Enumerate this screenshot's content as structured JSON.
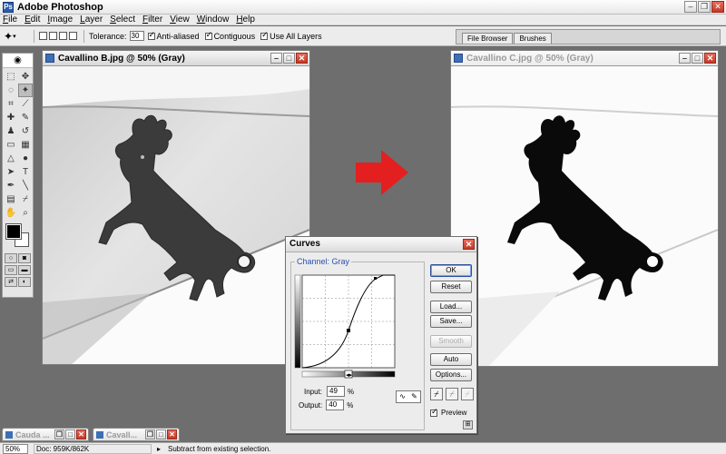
{
  "app": {
    "title": "Adobe Photoshop",
    "logo": "Ps"
  },
  "menu": [
    "File",
    "Edit",
    "Image",
    "Layer",
    "Select",
    "Filter",
    "View",
    "Window",
    "Help"
  ],
  "options": {
    "tolerance_label": "Tolerance:",
    "tolerance_value": "30",
    "anti_aliased": "Anti-aliased",
    "contiguous": "Contiguous",
    "use_all_layers": "Use All Layers"
  },
  "palette_well": {
    "tabs": [
      "File Browser",
      "Brushes"
    ]
  },
  "docs": {
    "left_title": "Cavallino B.jpg @ 50% (Gray)",
    "right_title": "Cavallino C.jpg @ 50% (Gray)"
  },
  "curves": {
    "title": "Curves",
    "channel_label": "Channel:",
    "channel_value": "Gray",
    "ok": "OK",
    "reset": "Reset",
    "load": "Load...",
    "save": "Save...",
    "smooth": "Smooth",
    "auto": "Auto",
    "options": "Options...",
    "input_label": "Input:",
    "input_value": "49",
    "output_label": "Output:",
    "output_value": "40",
    "percent": "%",
    "preview": "Preview"
  },
  "minimized": [
    {
      "title": "Cauda ..."
    },
    {
      "title": "Cavall..."
    }
  ],
  "status": {
    "zoom": "50%",
    "doc_info": "Doc: 959K/862K",
    "message": "Subtract from existing selection."
  },
  "colors": {
    "workspace": "#6e6e6e",
    "arrow": "#e41f1f",
    "close_button": "#c33a27",
    "channel_label": "#2a4fb0"
  }
}
